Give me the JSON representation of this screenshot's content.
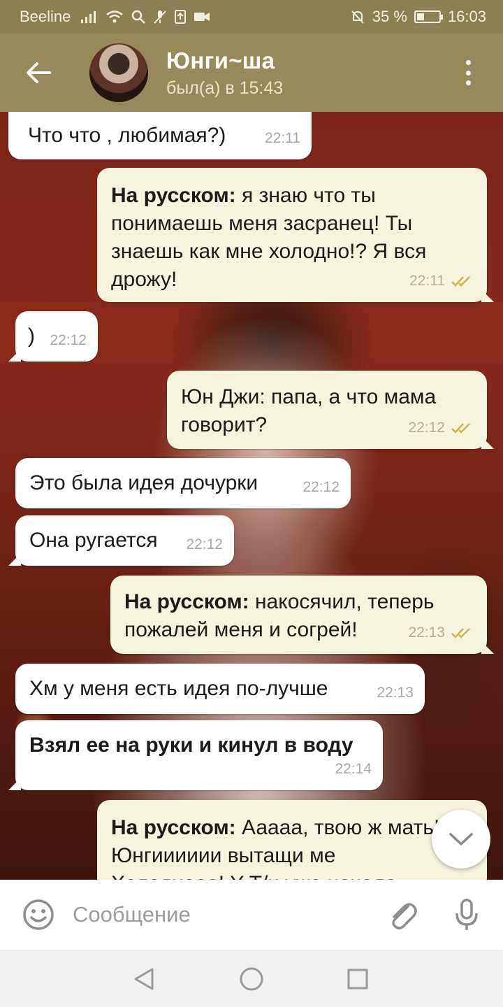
{
  "status_bar": {
    "carrier": "Beeline",
    "battery_percent_text": "35 %",
    "battery_level": 0.35,
    "time": "16:03"
  },
  "header": {
    "contact_name": "Юнги~ша",
    "last_seen": "был(а) в 15:43"
  },
  "messages": [
    {
      "dir": "in",
      "text": "Что что , любимая?)",
      "bold_prefix": "",
      "time": "22:11"
    },
    {
      "dir": "out",
      "bold_prefix": "На русском:",
      "text": " я знаю что ты понимаешь меня засранец! Ты знаешь как мне холодно!? Я вся дрожу!",
      "time": "22:11",
      "status": "read"
    },
    {
      "dir": "in",
      "text": ")",
      "bold_prefix": "",
      "time": "22:12"
    },
    {
      "dir": "out",
      "bold_prefix": "",
      "text": "Юн Джи: папа, а что мама говорит?",
      "time": "22:12",
      "status": "read"
    },
    {
      "dir": "in",
      "text": "Это была идея дочурки",
      "bold_prefix": "",
      "time": "22:12"
    },
    {
      "dir": "in",
      "text": "Она ругается",
      "bold_prefix": "",
      "time": "22:12"
    },
    {
      "dir": "out",
      "bold_prefix": "На русском:",
      "text": " накосячил, теперь пожалей меня и согрей!",
      "time": "22:13",
      "status": "read"
    },
    {
      "dir": "in",
      "text": "Хм у меня есть идея по-лучше",
      "bold_prefix": "",
      "time": "22:13"
    },
    {
      "dir": "in",
      "bold_prefix": "Взял ее на руки и кинул в воду",
      "text": "",
      "time": "22:14"
    },
    {
      "dir": "out",
      "bold_prefix": "На русском:",
      "text": " Ааааа, твою ж мать! Юнгииииии вытащи ме",
      "partial_line": "Холоднооо! Y T/и уже начала",
      "time": "",
      "status": ""
    }
  ],
  "input": {
    "placeholder": "Сообщение"
  },
  "icons": {
    "back": "arrow-left-icon",
    "menu": "more-vertical-icon",
    "emoji": "smiley-icon",
    "attach": "paperclip-icon",
    "mic": "microphone-icon",
    "scroll": "chevron-down-icon",
    "nav_back": "triangle-back-icon",
    "nav_home": "circle-home-icon",
    "nav_recent": "square-recent-icon"
  },
  "colors": {
    "header": "#978a5a",
    "status_bar": "#8b7f54",
    "bubble_in": "#ffffff",
    "bubble_out": "#f6f3df",
    "read_tick": "#c9b84a"
  }
}
